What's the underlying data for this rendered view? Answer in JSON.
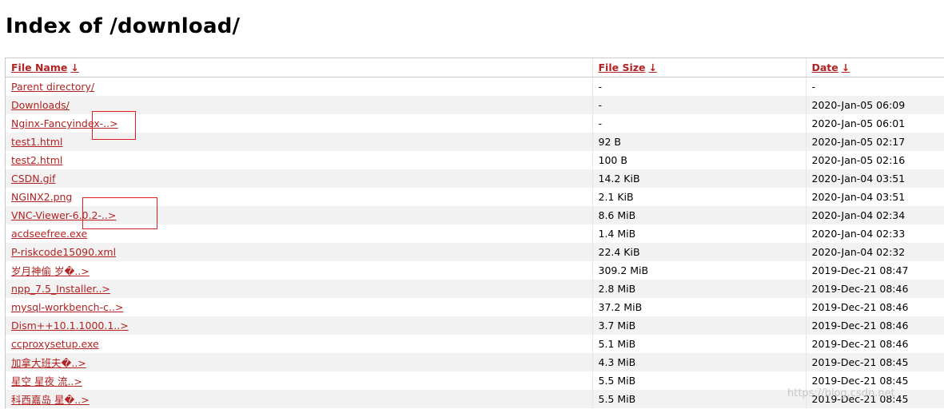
{
  "page": {
    "title": "Index of /download/"
  },
  "columns": {
    "name": "File Name",
    "size": "File Size",
    "date": "Date",
    "sort_arrow": "↓"
  },
  "rows": [
    {
      "name": "Parent directory/",
      "size": "-",
      "date": "-"
    },
    {
      "name": "Downloads/",
      "size": "-",
      "date": "2020-Jan-05 06:09"
    },
    {
      "name": "Nginx-Fancyindex-..>",
      "size": "-",
      "date": "2020-Jan-05 06:01"
    },
    {
      "name": "test1.html",
      "size": "92 B",
      "date": "2020-Jan-05 02:17"
    },
    {
      "name": "test2.html",
      "size": "100 B",
      "date": "2020-Jan-05 02:16"
    },
    {
      "name": "CSDN.gif",
      "size": "14.2 KiB",
      "date": "2020-Jan-04 03:51"
    },
    {
      "name": "NGINX2.png",
      "size": "2.1 KiB",
      "date": "2020-Jan-04 03:51"
    },
    {
      "name": "VNC-Viewer-6.0.2-..>",
      "size": "8.6 MiB",
      "date": "2020-Jan-04 02:34"
    },
    {
      "name": "acdseefree.exe",
      "size": "1.4 MiB",
      "date": "2020-Jan-04 02:33"
    },
    {
      "name": "P-riskcode15090.xml",
      "size": "22.4 KiB",
      "date": "2020-Jan-04 02:32"
    },
    {
      "name": "岁月神偷 岁�..>",
      "size": "309.2 MiB",
      "date": "2019-Dec-21 08:47"
    },
    {
      "name": "npp_7.5_Installer..>",
      "size": "2.8 MiB",
      "date": "2019-Dec-21 08:46"
    },
    {
      "name": "mysql-workbench-c..>",
      "size": "37.2 MiB",
      "date": "2019-Dec-21 08:46"
    },
    {
      "name": "Dism++10.1.1000.1..>",
      "size": "3.7 MiB",
      "date": "2019-Dec-21 08:46"
    },
    {
      "name": "ccproxysetup.exe",
      "size": "5.1 MiB",
      "date": "2019-Dec-21 08:46"
    },
    {
      "name": "加拿大班夫�..>",
      "size": "4.3 MiB",
      "date": "2019-Dec-21 08:45"
    },
    {
      "name": "星空 星夜 流..>",
      "size": "5.5 MiB",
      "date": "2019-Dec-21 08:45"
    },
    {
      "name": "科西嘉岛 星�..>",
      "size": "5.5 MiB",
      "date": "2019-Dec-21 08:45"
    }
  ],
  "watermark": "https://blog.csdn.net",
  "colors": {
    "link": "#b22222",
    "stripe": "#f2f2f2",
    "highlight_box": "#e02020"
  }
}
